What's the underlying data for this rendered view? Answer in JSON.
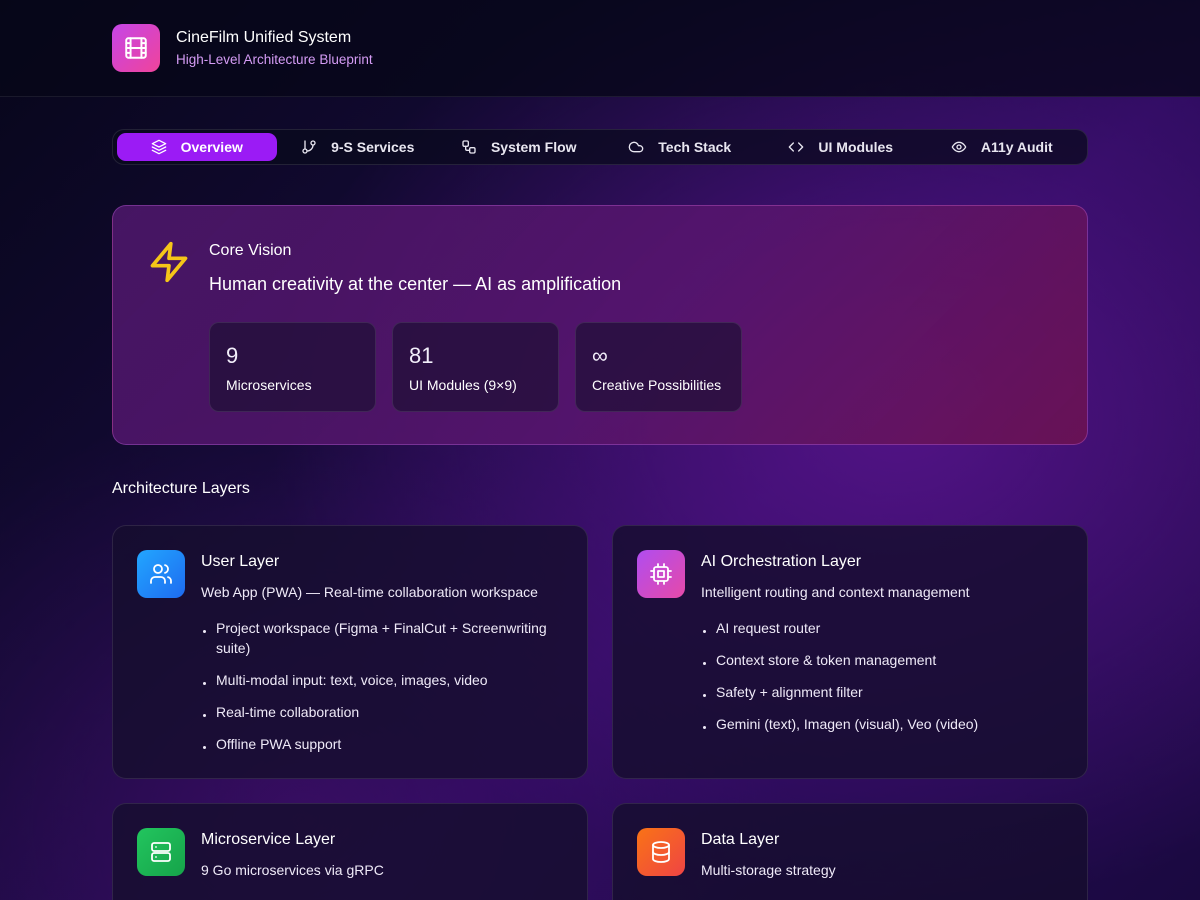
{
  "header": {
    "icon": "film-icon",
    "title": "CineFilm Unified System",
    "subtitle": "High-Level Architecture Blueprint"
  },
  "tabs": [
    {
      "label": "Overview",
      "icon": "layers-icon",
      "active": true
    },
    {
      "label": "9-S Services",
      "icon": "git-branch-icon",
      "active": false
    },
    {
      "label": "System Flow",
      "icon": "workflow-icon",
      "active": false
    },
    {
      "label": "Tech Stack",
      "icon": "cloud-icon",
      "active": false
    },
    {
      "label": "UI Modules",
      "icon": "code-icon",
      "active": false
    },
    {
      "label": "A11y Audit",
      "icon": "eye-icon",
      "active": false
    }
  ],
  "vision": {
    "icon": "lightning-icon",
    "title": "Core Vision",
    "tagline": "Human creativity at the center — AI as amplification",
    "stats": [
      {
        "value": "9",
        "label": "Microservices"
      },
      {
        "value": "81",
        "label": "UI Modules (9×9)"
      },
      {
        "value": "∞",
        "label": "Creative Possibilities"
      }
    ]
  },
  "layers_heading": "Architecture Layers",
  "layers": [
    {
      "title": "User Layer",
      "subtitle": "Web App (PWA) — Real-time collaboration workspace",
      "icon": "users-icon",
      "bullets": [
        "Project workspace (Figma + FinalCut + Screenwriting suite)",
        "Multi-modal input: text, voice, images, video",
        "Real-time collaboration",
        "Offline PWA support"
      ]
    },
    {
      "title": "AI Orchestration Layer",
      "subtitle": "Intelligent routing and context management",
      "icon": "cpu-icon",
      "bullets": [
        "AI request router",
        "Context store & token management",
        "Safety + alignment filter",
        "Gemini (text), Imagen (visual), Veo (video)"
      ]
    },
    {
      "title": "Microservice Layer",
      "subtitle": "9 Go microservices via gRPC",
      "icon": "server-icon",
      "bullets": []
    },
    {
      "title": "Data Layer",
      "subtitle": "Multi-storage strategy",
      "icon": "database-icon",
      "bullets": []
    }
  ],
  "colors": {
    "accent": "#9b1bf5",
    "subtitle": "#d59cf5",
    "lightning": "#f5c518",
    "user_layer": "#1e90ff",
    "ai_layer": "#c545e8",
    "microservice_layer": "#1fbf5c",
    "data_layer": "#f25a1e"
  }
}
